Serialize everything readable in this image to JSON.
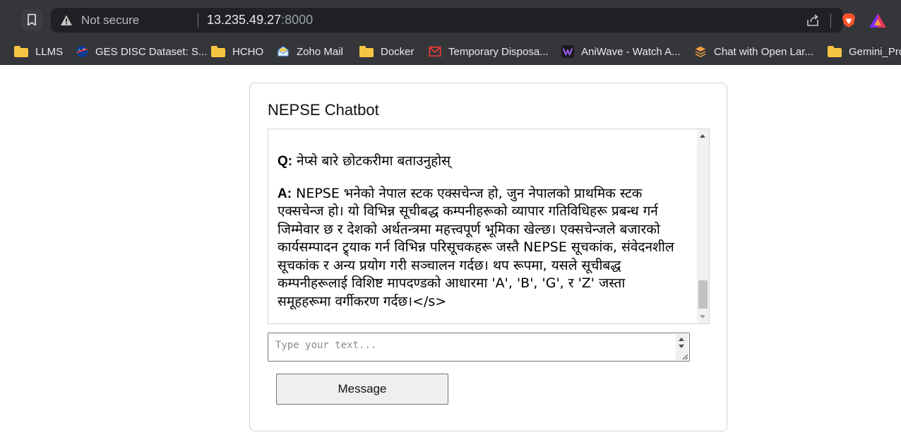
{
  "browser": {
    "security_status": "Not secure",
    "url_host": "13.235.49.27",
    "url_port": ":8000",
    "bookmarks": [
      {
        "label": "LLMS",
        "icon": "folder-icon"
      },
      {
        "label": "GES DISC Dataset: S...",
        "icon": "nasa-icon"
      },
      {
        "label": "HCHO",
        "icon": "folder-icon"
      },
      {
        "label": "Zoho Mail",
        "icon": "zoho-mail-icon"
      },
      {
        "label": "Docker",
        "icon": "folder-icon"
      },
      {
        "label": "Temporary Disposa...",
        "icon": "temp-mail-icon"
      },
      {
        "label": "AniWave - Watch A...",
        "icon": "aniwave-icon"
      },
      {
        "label": "Chat with Open Lar...",
        "icon": "layers-icon"
      },
      {
        "label": "Gemini_Pro",
        "icon": "folder-icon"
      }
    ]
  },
  "app": {
    "title": "NEPSE Chatbot",
    "messages": [
      {
        "label": "Q:",
        "text": "नेप्से बारे छोटकरीमा बताउनुहोस्"
      },
      {
        "label": "A:",
        "text": "NEPSE भनेको नेपाल स्टक एक्सचेन्ज हो, जुन नेपालको प्राथमिक स्टक एक्सचेन्ज हो। यो विभिन्न सूचीबद्ध कम्पनीहरूको व्यापार गतिविधिहरू प्रबन्ध गर्न जिम्मेवार छ र देशको अर्थतन्त्रमा महत्त्वपूर्ण भूमिका खेल्छ। एक्सचेन्जले बजारको कार्यसम्पादन ट्र्याक गर्न विभिन्न परिसूचकहरू जस्तै NEPSE सूचकांक, संवेदनशील सूचकांक र अन्य प्रयोग गरी सञ्चालन गर्दछ। थप रूपमा, यसले सूचीबद्ध कम्पनीहरूलाई विशिष्ट मापदण्डको आधारमा 'A', 'B', 'G', र 'Z' जस्ता समूहहरूमा वर्गीकरण गर्दछ।</s>"
      }
    ],
    "input_placeholder": "Type your text...",
    "send_label": "Message"
  }
}
